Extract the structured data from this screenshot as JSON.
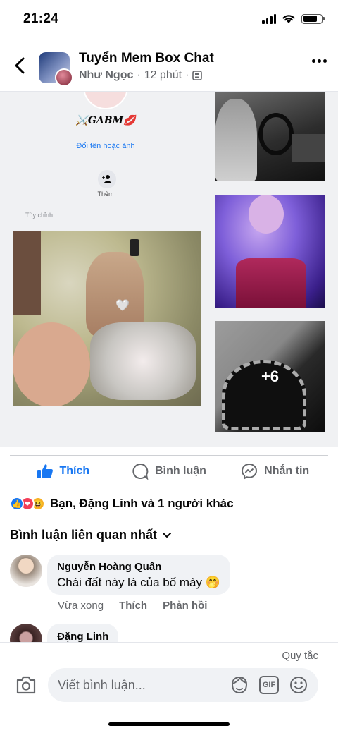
{
  "status_bar": {
    "time": "21:24"
  },
  "header": {
    "group_name": "Tuyển Mem Box Chat",
    "author": "Như Ngọc",
    "separator": "·",
    "time_ago": "12 phút",
    "separator2": "·"
  },
  "media": {
    "profile_name": "⚔️GABM💋",
    "rename_link": "Đổi tên hoặc ảnh",
    "add_label": "Thêm",
    "customize_label": "Tùy chỉnh",
    "more_count": "+6",
    "heart": "🤍"
  },
  "actions": {
    "like": "Thích",
    "comment": "Bình luận",
    "message": "Nhắn tin"
  },
  "reactions": {
    "icons": [
      "like",
      "love",
      "haha"
    ],
    "text": "Bạn, Đặng Linh và 1 người khác"
  },
  "comments": {
    "sort_label": "Bình luận liên quan nhất",
    "items": [
      {
        "name": "Nguyễn Hoàng Quân",
        "text": "Chái đất này là của bố mày 🤭",
        "time": "Vừa xong",
        "like": "Thích",
        "reply": "Phản hồi"
      },
      {
        "name": "Đặng Linh"
      }
    ]
  },
  "composer": {
    "rules": "Quy tắc",
    "placeholder": "Viết bình luận...",
    "gif": "GIF"
  },
  "colors": {
    "accent": "#1877f2",
    "secondary_text": "#65676b",
    "bubble": "#f0f2f5"
  }
}
